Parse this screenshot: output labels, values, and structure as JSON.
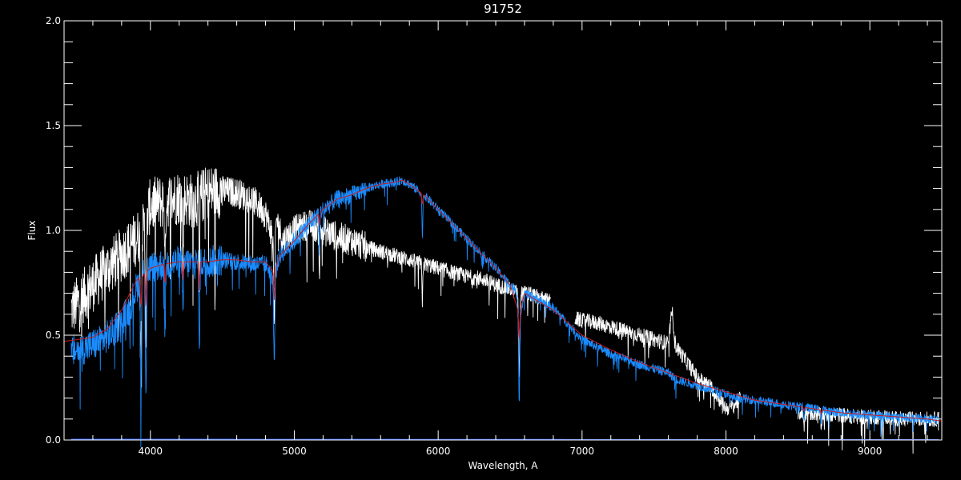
{
  "chart_data": {
    "type": "line",
    "title": "91752",
    "xlabel": "Wavelength, A",
    "ylabel": "Flux",
    "xlim": [
      3400,
      9500
    ],
    "ylim": [
      0.0,
      2.0
    ],
    "x_ticks": [
      4000,
      5000,
      6000,
      7000,
      8000,
      9000
    ],
    "x_tick_labels": [
      "4000",
      "5000",
      "6000",
      "7000",
      "8000",
      "9000"
    ],
    "y_ticks": [
      0.0,
      0.5,
      1.0,
      1.5,
      2.0
    ],
    "y_tick_labels": [
      "0.0",
      "0.5",
      "1.0",
      "1.5",
      "2.0"
    ],
    "grid": false,
    "background": "#000000",
    "axis_color": "#ffffff",
    "series": [
      {
        "color": "#ffffff",
        "noise": 0.06,
        "x": [
          3450,
          3550,
          3650,
          3750,
          3850,
          3950,
          4000,
          4100,
          4200,
          4300,
          4400,
          4500,
          4600,
          4700,
          4750,
          4800,
          4850,
          4880,
          4920,
          5000,
          5100,
          5200,
          5300,
          5400,
          5500,
          5600,
          5700,
          5800,
          5900,
          6000,
          6100,
          6200,
          6300,
          6400,
          6500,
          6560,
          6620,
          6700,
          6780,
          null,
          6950,
          7000,
          7100,
          7200,
          7300,
          7400,
          7500,
          7600,
          7625,
          7650,
          7700,
          7800,
          7900,
          7950,
          8000,
          8050,
          8100,
          null,
          8500,
          8600,
          8700,
          8800,
          8900,
          9000,
          9100,
          9200,
          9300,
          9400,
          9480
        ],
        "y": [
          0.62,
          0.7,
          0.78,
          0.85,
          0.92,
          1.0,
          1.12,
          1.14,
          1.16,
          1.14,
          1.18,
          1.19,
          1.18,
          1.15,
          1.12,
          1.08,
          0.97,
          1.05,
          0.95,
          1.0,
          1.03,
          1.0,
          0.97,
          0.95,
          0.92,
          0.9,
          0.88,
          0.86,
          0.84,
          0.82,
          0.8,
          0.78,
          0.77,
          0.74,
          0.72,
          0.7,
          0.7,
          0.68,
          0.66,
          null,
          0.58,
          0.57,
          0.56,
          0.54,
          0.52,
          0.5,
          0.48,
          0.46,
          0.62,
          0.45,
          0.4,
          0.3,
          0.25,
          0.2,
          0.15,
          0.16,
          0.2,
          null,
          0.13,
          0.13,
          0.12,
          0.12,
          0.11,
          0.11,
          0.11,
          0.1,
          0.1,
          0.1,
          0.1
        ]
      },
      {
        "color": "#1a8cff",
        "noise": 0.035,
        "x": [
          3450,
          3550,
          3650,
          3750,
          3850,
          3900,
          3950,
          4000,
          4100,
          4200,
          4300,
          4400,
          4500,
          4600,
          4700,
          4800,
          4850,
          4900,
          5000,
          5100,
          5200,
          5300,
          5400,
          5500,
          5600,
          5700,
          5750,
          5800,
          5900,
          6000,
          6100,
          6200,
          6300,
          6400,
          6500,
          6540,
          6565,
          6600,
          6700,
          6800,
          7000,
          7200,
          7400,
          7600,
          7650,
          7700,
          7800,
          7900,
          8000,
          8050,
          8100,
          8200,
          8400,
          8600,
          8800,
          9000,
          9200,
          9400,
          9480
        ],
        "y": [
          0.42,
          0.44,
          0.47,
          0.52,
          0.62,
          0.72,
          0.8,
          0.82,
          0.84,
          0.85,
          0.84,
          0.85,
          0.86,
          0.85,
          0.84,
          0.84,
          0.78,
          0.88,
          0.95,
          1.03,
          1.1,
          1.15,
          1.17,
          1.2,
          1.22,
          1.23,
          1.24,
          1.22,
          1.17,
          1.1,
          1.03,
          0.96,
          0.89,
          0.82,
          0.74,
          0.72,
          0.58,
          0.7,
          0.67,
          0.63,
          0.48,
          0.41,
          0.36,
          0.32,
          0.29,
          0.28,
          0.26,
          0.24,
          0.22,
          0.2,
          0.2,
          0.19,
          0.17,
          0.15,
          0.13,
          0.12,
          0.11,
          0.1,
          0.1
        ]
      },
      {
        "color": "#cc1a1a",
        "noise": 0.0,
        "x": [
          3400,
          3500,
          3600,
          3700,
          3800,
          3900,
          4000,
          4100,
          4200,
          4300,
          4400,
          4500,
          4600,
          4700,
          4800,
          4860,
          4900,
          5000,
          5100,
          5200,
          5300,
          5400,
          5500,
          5600,
          5700,
          5750,
          5800,
          5900,
          6000,
          6100,
          6200,
          6300,
          6400,
          6500,
          6563,
          6600,
          6700,
          6800,
          6900,
          7000,
          7200,
          7400,
          7600,
          7800,
          8000,
          8200,
          8400,
          8600,
          8800,
          9000,
          9200,
          9400,
          9500
        ],
        "y": [
          0.47,
          0.48,
          0.49,
          0.53,
          0.62,
          0.76,
          0.82,
          0.84,
          0.85,
          0.85,
          0.85,
          0.86,
          0.86,
          0.85,
          0.85,
          0.8,
          0.88,
          0.95,
          1.03,
          1.1,
          1.15,
          1.17,
          1.2,
          1.22,
          1.23,
          1.24,
          1.22,
          1.17,
          1.1,
          1.03,
          0.96,
          0.89,
          0.82,
          0.74,
          0.6,
          0.7,
          0.66,
          0.62,
          0.56,
          0.5,
          0.43,
          0.37,
          0.32,
          0.27,
          0.23,
          0.19,
          0.17,
          0.15,
          0.13,
          0.12,
          0.11,
          0.1,
          0.09
        ]
      },
      {
        "color": "#3366ff",
        "noise": 0.0,
        "x": [
          3450,
          9480
        ],
        "y": [
          0.004,
          0.002
        ]
      }
    ],
    "absorption_lines": [
      {
        "x": 3934,
        "depth": 0.5,
        "width": 4
      },
      {
        "x": 3969,
        "depth": 0.55,
        "width": 4
      },
      {
        "x": 4102,
        "depth": 0.35,
        "width": 3
      },
      {
        "x": 4227,
        "depth": 0.3,
        "width": 3
      },
      {
        "x": 4340,
        "depth": 0.45,
        "width": 3
      },
      {
        "x": 4861,
        "depth": 0.45,
        "width": 4
      },
      {
        "x": 5175,
        "depth": 0.2,
        "width": 3
      },
      {
        "x": 5890,
        "depth": 0.2,
        "width": 3
      },
      {
        "x": 6563,
        "depth": 0.4,
        "width": 4
      },
      {
        "x": 8542,
        "depth": 0.07,
        "width": 3
      },
      {
        "x": 8662,
        "depth": 0.07,
        "width": 3
      }
    ]
  }
}
